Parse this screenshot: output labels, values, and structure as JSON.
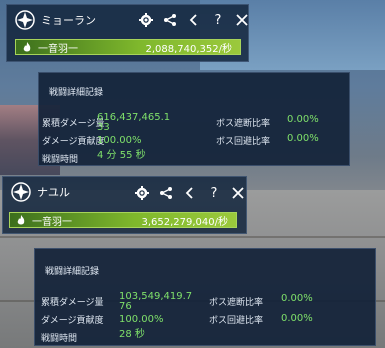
{
  "panels": [
    {
      "player_name": "ミョーラン",
      "skill_name": "一音羽一",
      "total_damage_rate": "2,088,740,352/秒",
      "detail_title": "戦闘詳細記録",
      "stats": {
        "total_damage_label": "累積ダメージ量",
        "total_damage_value_line1": "616,437,465.1",
        "total_damage_value_line2": "33",
        "contribution_label": "ダメージ貢献度",
        "contribution_value": "100.00%",
        "time_label": "戦闘時間",
        "time_value": "4 分 55 秒",
        "boss_block_label": "ボス遮断比率",
        "boss_block_value": "0.00%",
        "boss_dodge_label": "ボス回避比率",
        "boss_dodge_value": "0.00%"
      }
    },
    {
      "player_name": "ナユル",
      "skill_name": "一音羽一",
      "total_damage_rate": "3,652,279,040/秒",
      "detail_title": "戦闘詳細記録",
      "stats": {
        "total_damage_label": "累積ダメージ量",
        "total_damage_value_line1": "103,549,419.7",
        "total_damage_value_line2": "76",
        "contribution_label": "ダメージ貢献度",
        "contribution_value": "100.00%",
        "time_label": "戦闘時間",
        "time_value": "28 秒",
        "boss_block_label": "ボス遮断比率",
        "boss_block_value": "0.00%",
        "boss_dodge_label": "ボス回避比率",
        "boss_dodge_value": "0.00%"
      }
    }
  ],
  "toolbar": {
    "settings_icon": "gear-icon",
    "share_icon": "share-icon",
    "back_icon": "chevron-left-icon",
    "help_label": "?",
    "close_icon": "close-icon"
  },
  "colors": {
    "accent_green": "#7fe06a",
    "bar_green": "#7fb82c",
    "panel_bg": "#14263e"
  }
}
